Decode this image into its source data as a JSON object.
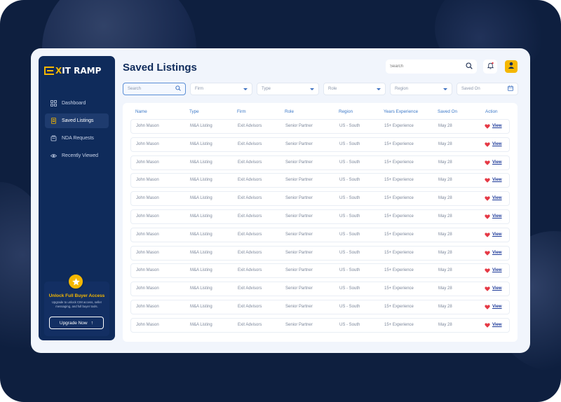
{
  "app": {
    "brand_prefix": "E",
    "brand_x": "X",
    "brand_suffix": "IT RAMP",
    "colors": {
      "navy": "#0f2b5b",
      "accent": "#f5b700",
      "link": "#3b78c8",
      "heart": "#e53945"
    }
  },
  "sidebar": {
    "items": [
      {
        "label": "Dashboard",
        "icon": "grid-icon",
        "active": false
      },
      {
        "label": "Saved Listings",
        "icon": "bookmark-icon",
        "active": true
      },
      {
        "label": "NDA Requests",
        "icon": "document-stack-icon",
        "active": false
      },
      {
        "label": "Recently Viewed",
        "icon": "eye-icon",
        "active": false
      }
    ],
    "promo": {
      "icon": "star-icon",
      "title": "Unlock Full Buyer Access",
      "text": "Upgrade to unlock CIM access, seller messaging, and full buyer tools.",
      "button": "Upgrade Now"
    }
  },
  "header": {
    "title": "Saved Listings",
    "search_placeholder": "Search"
  },
  "filters": {
    "search_placeholder": "Search",
    "firm": "Firm",
    "type": "Type",
    "role": "Role",
    "region": "Region",
    "saved_on": "Saved On"
  },
  "table": {
    "columns": [
      "Name",
      "Type",
      "Firm",
      "Role",
      "Region",
      "Years Experience",
      "Saved On",
      "Action"
    ],
    "rows": [
      {
        "name": "John Mason",
        "type": "M&A Listing",
        "firm": "Exit Advisors",
        "role": "Senior Partner",
        "region": "US - South",
        "experience": "15+ Experience",
        "saved_on": "May 28",
        "action": "View"
      },
      {
        "name": "John Mason",
        "type": "M&A Listing",
        "firm": "Exit Advisors",
        "role": "Senior Partner",
        "region": "US - South",
        "experience": "15+ Experience",
        "saved_on": "May 28",
        "action": "View"
      },
      {
        "name": "John Mason",
        "type": "M&A Listing",
        "firm": "Exit Advisors",
        "role": "Senior Partner",
        "region": "US - South",
        "experience": "15+ Experience",
        "saved_on": "May 28",
        "action": "View"
      },
      {
        "name": "John Mason",
        "type": "M&A Listing",
        "firm": "Exit Advisors",
        "role": "Senior Partner",
        "region": "US - South",
        "experience": "15+ Experience",
        "saved_on": "May 28",
        "action": "View"
      },
      {
        "name": "John Mason",
        "type": "M&A Listing",
        "firm": "Exit Advisors",
        "role": "Senior Partner",
        "region": "US - South",
        "experience": "15+ Experience",
        "saved_on": "May 28",
        "action": "View"
      },
      {
        "name": "John Mason",
        "type": "M&A Listing",
        "firm": "Exit Advisors",
        "role": "Senior Partner",
        "region": "US - South",
        "experience": "15+ Experience",
        "saved_on": "May 28",
        "action": "View"
      },
      {
        "name": "John Mason",
        "type": "M&A Listing",
        "firm": "Exit Advisors",
        "role": "Senior Partner",
        "region": "US - South",
        "experience": "15+ Experience",
        "saved_on": "May 28",
        "action": "View"
      },
      {
        "name": "John Mason",
        "type": "M&A Listing",
        "firm": "Exit Advisors",
        "role": "Senior Partner",
        "region": "US - South",
        "experience": "15+ Experience",
        "saved_on": "May 28",
        "action": "View"
      },
      {
        "name": "John Mason",
        "type": "M&A Listing",
        "firm": "Exit Advisors",
        "role": "Senior Partner",
        "region": "US - South",
        "experience": "15+ Experience",
        "saved_on": "May 28",
        "action": "View"
      },
      {
        "name": "John Mason",
        "type": "M&A Listing",
        "firm": "Exit Advisors",
        "role": "Senior Partner",
        "region": "US - South",
        "experience": "15+ Experience",
        "saved_on": "May 28",
        "action": "View"
      },
      {
        "name": "John Mason",
        "type": "M&A Listing",
        "firm": "Exit Advisors",
        "role": "Senior Partner",
        "region": "US - South",
        "experience": "15+ Experience",
        "saved_on": "May 28",
        "action": "View"
      },
      {
        "name": "John Mason",
        "type": "M&A Listing",
        "firm": "Exit Advisors",
        "role": "Senior Partner",
        "region": "US - South",
        "experience": "15+ Experience",
        "saved_on": "May 28",
        "action": "View"
      }
    ]
  }
}
